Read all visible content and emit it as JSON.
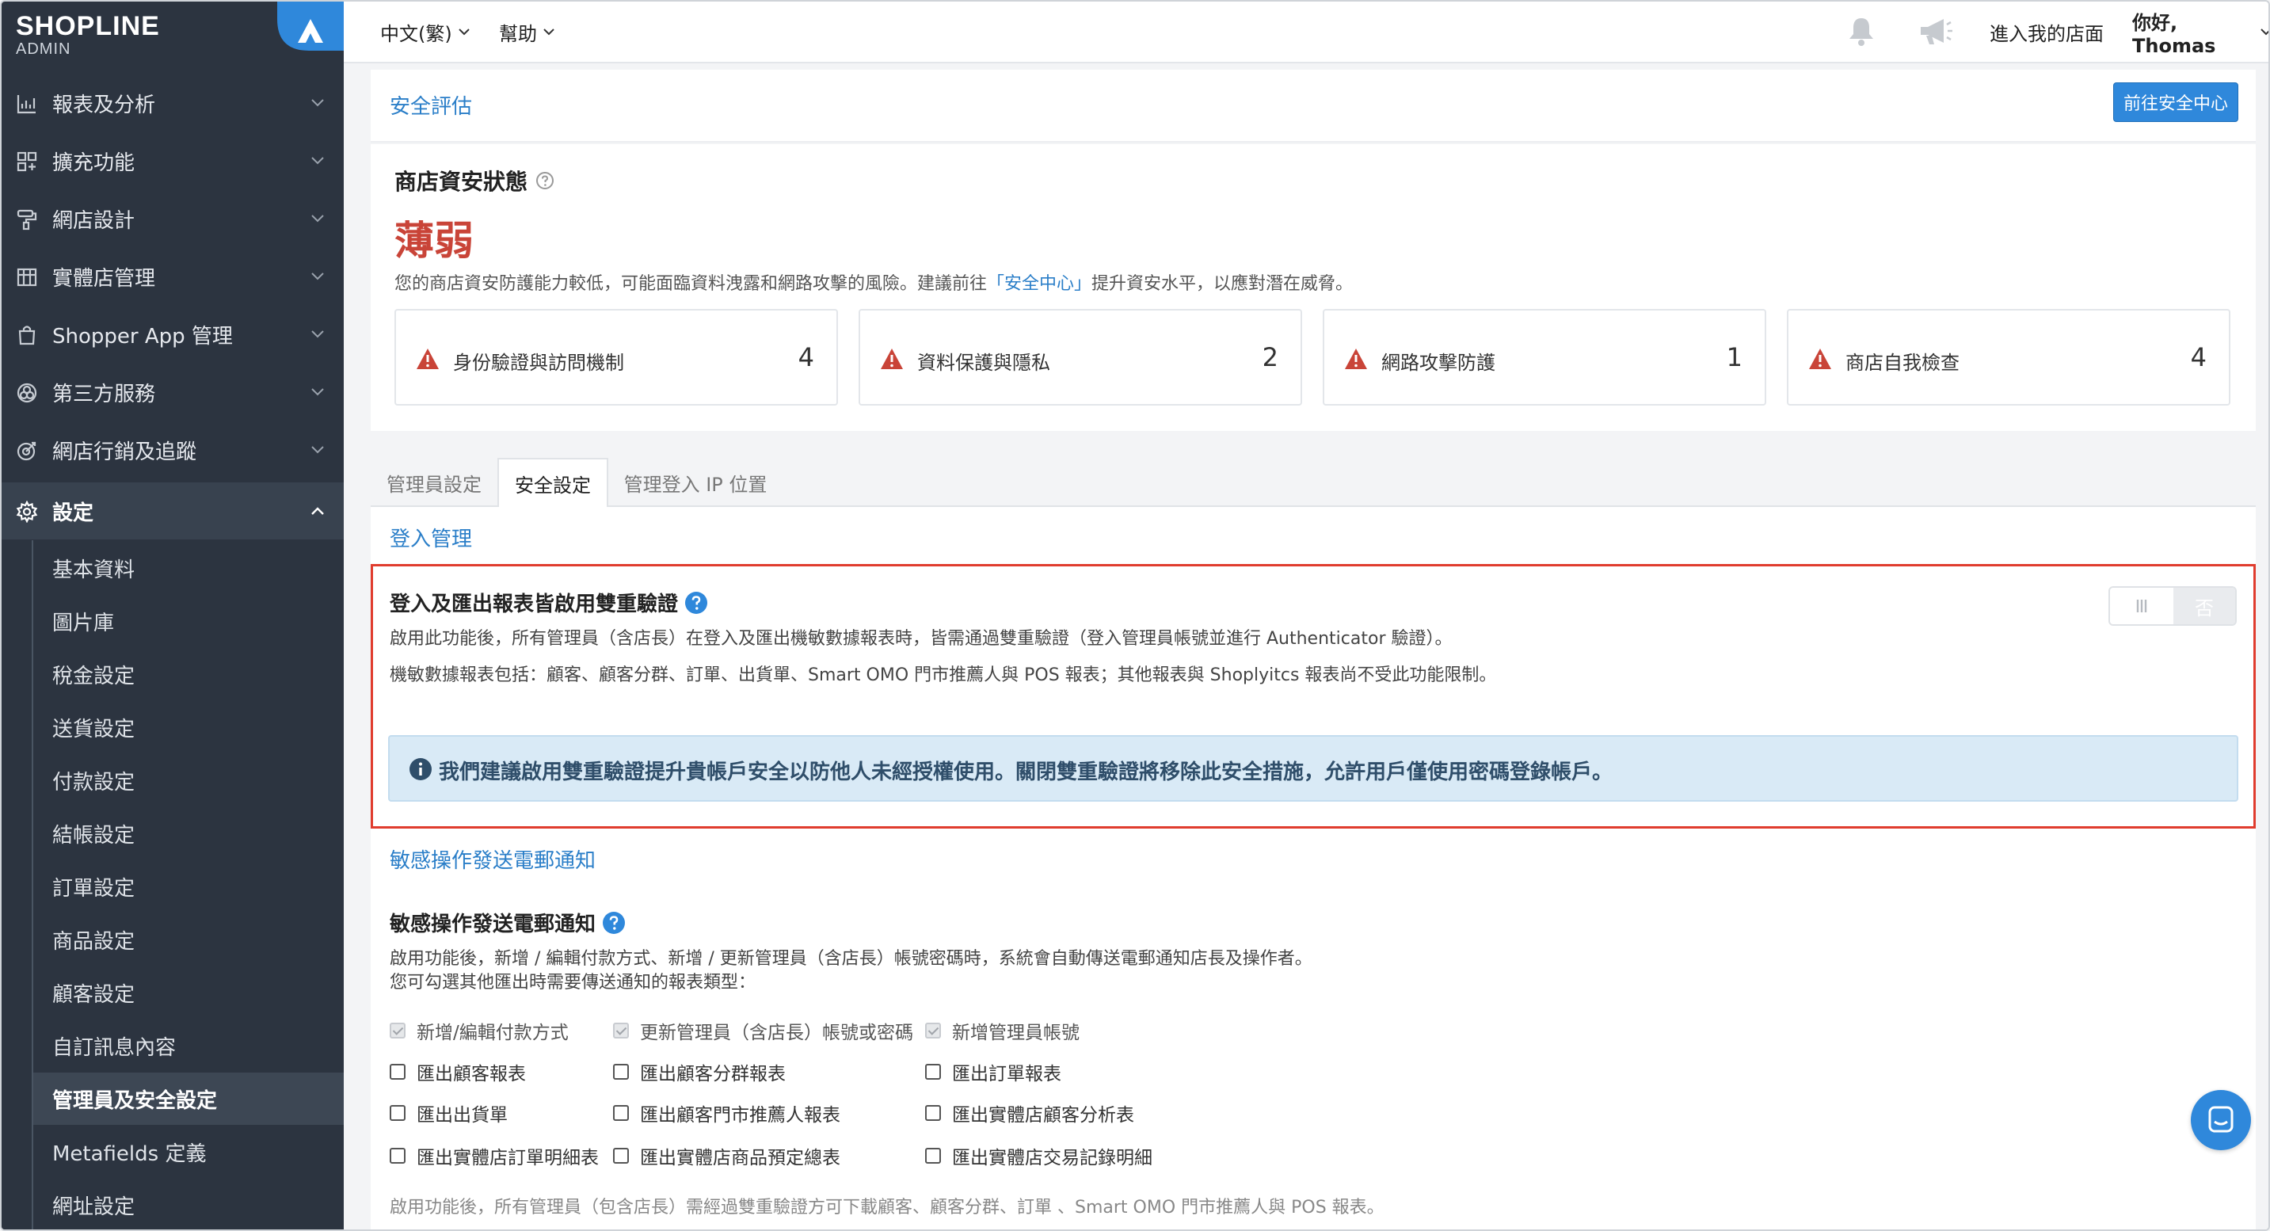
{
  "brand": {
    "name": "SHOPLINE",
    "sub": "ADMIN"
  },
  "sidebar": {
    "items": [
      {
        "label": "報表及分析",
        "icon": "chart-icon"
      },
      {
        "label": "擴充功能",
        "icon": "apps-icon"
      },
      {
        "label": "網店設計",
        "icon": "paint-roller-icon"
      },
      {
        "label": "實體店管理",
        "icon": "store-icon"
      },
      {
        "label": "Shopper App 管理",
        "icon": "shopping-bag-icon"
      },
      {
        "label": "第三方服務",
        "icon": "integrations-icon"
      },
      {
        "label": "網店行銷及追蹤",
        "icon": "target-icon"
      },
      {
        "label": "設定",
        "icon": "gear-icon"
      }
    ],
    "sub_items": [
      "基本資料",
      "圖片庫",
      "稅金設定",
      "送貨設定",
      "付款設定",
      "結帳設定",
      "訂單設定",
      "商品設定",
      "顧客設定",
      "自訂訊息內容",
      "管理員及安全設定",
      "Metafields 定義",
      "網址設定"
    ]
  },
  "topbar": {
    "language": "中文(繁)",
    "help": "幫助",
    "enter_store": "進入我的店面",
    "greeting": "你好, Thomas"
  },
  "security": {
    "section_title": "安全評估",
    "goto_button": "前往安全中心",
    "status_title": "商店資安狀態",
    "status_value": "薄弱",
    "desc_before": "您的商店資安防護能力較低，可能面臨資料洩露和網路攻擊的風險。建議前往",
    "desc_link": "「安全中心」",
    "desc_after": "提升資安水平，以應對潛在威脅。",
    "cards": [
      {
        "label": "身份驗證與訪問機制",
        "count": "4"
      },
      {
        "label": "資料保護與隱私",
        "count": "2"
      },
      {
        "label": "網路攻擊防護",
        "count": "1"
      },
      {
        "label": "商店自我檢查",
        "count": "4"
      }
    ]
  },
  "tabs": [
    "管理員設定",
    "安全設定",
    "管理登入 IP 位置"
  ],
  "login": {
    "section_title": "登入管理",
    "setting_title": "登入及匯出報表皆啟用雙重驗證",
    "desc1": "啟用此功能後，所有管理員（含店長）在登入及匯出機敏數據報表時，皆需通過雙重驗證（登入管理員帳號並進行 Authenticator 驗證）。",
    "desc2": "機敏數據報表包括：顧客、顧客分群、訂單、出貨單、Smart OMO 門市推薦人與 POS 報表；其他報表與 Shoplyitcs 報表尚不受此功能限制。",
    "toggle_off": "否",
    "info": "我們建議啟用雙重驗證提升貴帳戶安全以防他人未經授權使用。關閉雙重驗證將移除此安全措施，允許用戶僅使用密碼登錄帳戶。"
  },
  "notify": {
    "section_title": "敏感操作發送電郵通知",
    "setting_title": "敏感操作發送電郵通知",
    "desc1": "啟用功能後，新增 / 編輯付款方式、新增 / 更新管理員（含店長）帳號密碼時，系統會自動傳送電郵通知店長及操作者。",
    "desc2": "您可勾選其他匯出時需要傳送通知的報表類型：",
    "checkboxes": [
      {
        "label": "新增/編輯付款方式",
        "checked": true
      },
      {
        "label": "更新管理員（含店長）帳號或密碼",
        "checked": true
      },
      {
        "label": "新增管理員帳號",
        "checked": true
      },
      {
        "label": "匯出顧客報表",
        "checked": false
      },
      {
        "label": "匯出顧客分群報表",
        "checked": false
      },
      {
        "label": "匯出訂單報表",
        "checked": false
      },
      {
        "label": "匯出出貨單",
        "checked": false
      },
      {
        "label": "匯出顧客門市推薦人報表",
        "checked": false
      },
      {
        "label": "匯出實體店顧客分析表",
        "checked": false
      },
      {
        "label": "匯出實體店訂單明細表",
        "checked": false
      },
      {
        "label": "匯出實體店商品預定總表",
        "checked": false
      },
      {
        "label": "匯出實體店交易記錄明細",
        "checked": false
      }
    ],
    "footer": "啟用功能後，所有管理員（包含店長）需經過雙重驗證方可下載顧客、顧客分群、訂單 、Smart OMO 門市推薦人與 POS 報表。"
  },
  "colors": {
    "sidebar": "#2c3440",
    "accent": "#2f88db",
    "danger": "#c94438",
    "highlight": "#e03c2e"
  }
}
